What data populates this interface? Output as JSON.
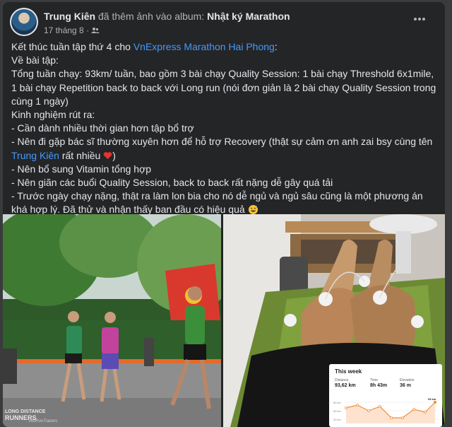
{
  "post": {
    "author": "Trung Kiên",
    "action": "đã thêm ảnh vào album:",
    "album": "Nhật ký Marathon",
    "date": "17 tháng 8",
    "separator": "·"
  },
  "icons": {
    "audience": "friends-icon",
    "menu": "more-options-icon",
    "emoji_heart": "red-heart-emoji",
    "emoji_sweat": "grinning-sweat-emoji"
  },
  "colors": {
    "link": "#4599ff",
    "text": "#e4e6eb",
    "muted": "#b0b3b8",
    "card": "#242526",
    "heart": "#e8322f",
    "chart_line": "#f28c38"
  },
  "text": {
    "l1_pre": "Kết thúc tuần tập thứ 4 cho ",
    "l1_link": "VnExpress Marathon Hai Phong",
    "l1_post": ":",
    "l2": "Về bài tập:",
    "l3": "Tổng tuần chạy: 93km/ tuần, bao gồm 3 bài chạy Quality Session: 1 bài chạy Threshold 6x1mile, 1 bài chạy Repetition back to back với Long run (nói đơn giản là 2 bài chạy Quality Session trong cùng 1 ngày)",
    "l4": "Kinh nghiệm rút ra:",
    "l5": "- Cần dành nhiều thời gian hơn tập bổ trợ",
    "l6_pre": "- Nên đi gặp bác sĩ thường xuyên hơn để hỗ trợ Recovery (thật sự cảm ơn anh zai bsy cùng tên ",
    "l6_link": "Trung Kiên",
    "l6_post": " rất nhiều ",
    "l7": "- Nên bổ sung Vitamin tổng hợp",
    "l8": "- Nên giãn các buổi Quality Session, back to back rất nặng dễ gây quá tải",
    "l9": "- Trước ngày chạy nặng, thật ra làm lon bia cho nó dễ ngủ và ngủ sâu cũng là một phương án khá hợp lý. Đã thử và nhận thấy ban đầu có hiệu quả"
  },
  "photo_left": {
    "watermark_top": "LONG DISTANCE",
    "watermark_bottom": "RUNNERS",
    "watermark_small": "VietRunTracers"
  },
  "stats": {
    "title": "This week",
    "distance_label": "Distance",
    "distance_value": "93,62 km",
    "time_label": "Time",
    "time_value": "8h 43m",
    "elevation_label": "Elevation",
    "elevation_value": "36 m",
    "peak_label": "93 km",
    "y_ticks": [
      "80 km",
      "60 km",
      "40 km"
    ]
  }
}
